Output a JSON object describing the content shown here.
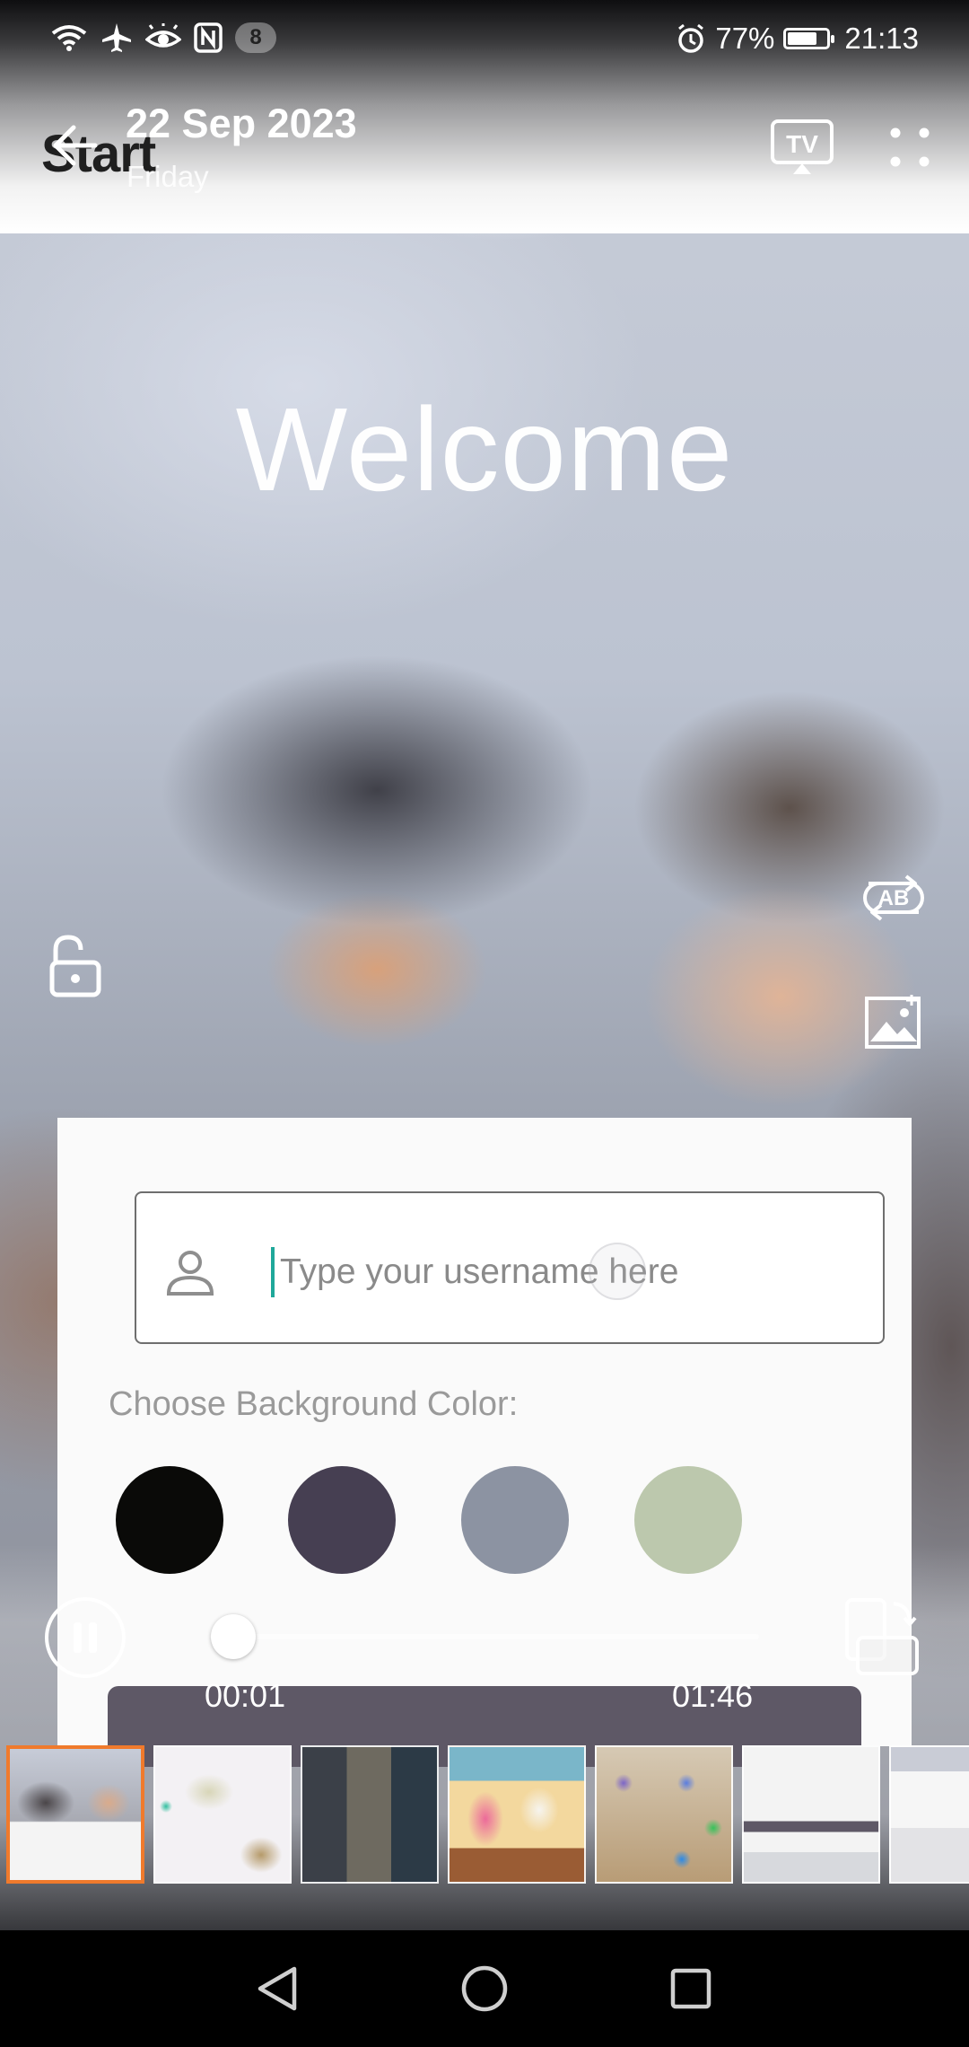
{
  "status_bar": {
    "notification_count": "8",
    "battery_percent": "77%",
    "battery_level": 0.77,
    "time": "21:13",
    "left_icons": [
      "wifi-icon",
      "airplane-mode-icon",
      "eye-comfort-icon",
      "nfc-icon"
    ],
    "right_icons": [
      "alarm-icon",
      "battery-icon"
    ]
  },
  "header": {
    "app_title": "Start",
    "date": "22 Sep 2023",
    "weekday": "Friday",
    "tv_label": "TV",
    "icons": [
      "back-arrow-icon",
      "tv-cast-icon",
      "more-options-icon"
    ]
  },
  "content": {
    "welcome": "Welcome",
    "username_placeholder": "Type your username here",
    "choose_color_label": "Choose Background Color:",
    "colors": [
      "#0a0a08",
      "#463f52",
      "#8c93a2",
      "#bcc8ad"
    ]
  },
  "side_controls": {
    "ab_label": "AB",
    "icons": [
      "unlock-icon",
      "ab-compare-icon",
      "image-frame-icon"
    ]
  },
  "player": {
    "current_time": "00:01",
    "total_time": "01:46",
    "progress": 0.01,
    "icons": [
      "pause-icon",
      "rotate-screen-icon"
    ]
  },
  "thumbnails": {
    "selected_index": 0,
    "count": 7
  },
  "navigation": {
    "icons": [
      "back-triangle-icon",
      "home-circle-icon",
      "recents-square-icon"
    ]
  }
}
